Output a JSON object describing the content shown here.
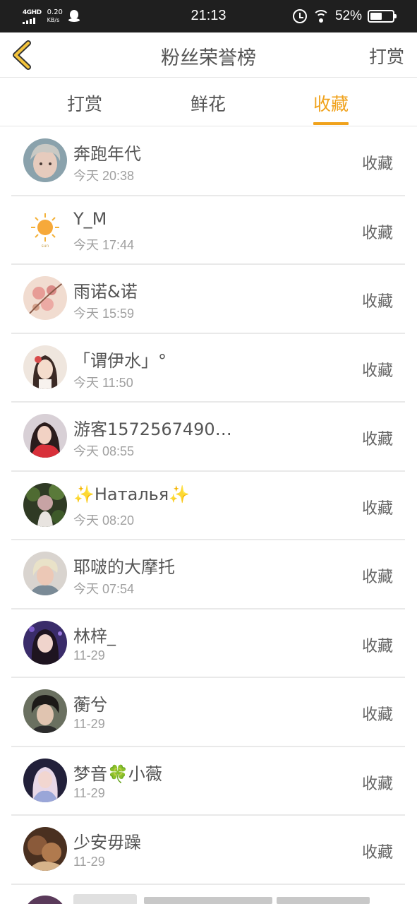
{
  "status_bar": {
    "network": "4GHD",
    "speed_value": "0.20",
    "speed_unit": "KB/s",
    "time": "21:13",
    "battery_percent": "52%",
    "battery_level": 0.52,
    "icons": [
      "signal-icon",
      "qq-icon",
      "alarm-icon",
      "wifi-icon",
      "battery-icon"
    ]
  },
  "header": {
    "title": "粉丝荣誉榜",
    "action_label": "打赏",
    "back_icon": "chevron-left-icon",
    "accent_color": "#f0a21c"
  },
  "tabs": [
    {
      "label": "打赏",
      "active": false
    },
    {
      "label": "鲜花",
      "active": false
    },
    {
      "label": "收藏",
      "active": true
    }
  ],
  "list": {
    "items": [
      {
        "name": "奔跑年代",
        "time": "今天 20:38",
        "action": "收藏"
      },
      {
        "name": "Y_M",
        "time": "今天 17:44",
        "action": "收藏"
      },
      {
        "name": "雨诺&诺",
        "time": "今天 15:59",
        "action": "收藏"
      },
      {
        "name": "「谓伊水」°",
        "time": "今天 11:50",
        "action": "收藏"
      },
      {
        "name": "游客1572567490…",
        "time": "今天 08:55",
        "action": "收藏"
      },
      {
        "name": "✨Наталья✨",
        "time": "今天 08:20",
        "action": "收藏"
      },
      {
        "name": "耶啵的大摩托",
        "time": "今天 07:54",
        "action": "收藏"
      },
      {
        "name": "林梓_",
        "time": "11-29",
        "action": "收藏"
      },
      {
        "name": "蘅兮",
        "time": "11-29",
        "action": "收藏"
      },
      {
        "name": "梦音🍀小薇",
        "time": "11-29",
        "action": "收藏"
      },
      {
        "name": "少安毋躁",
        "time": "11-29",
        "action": "收藏"
      }
    ]
  }
}
